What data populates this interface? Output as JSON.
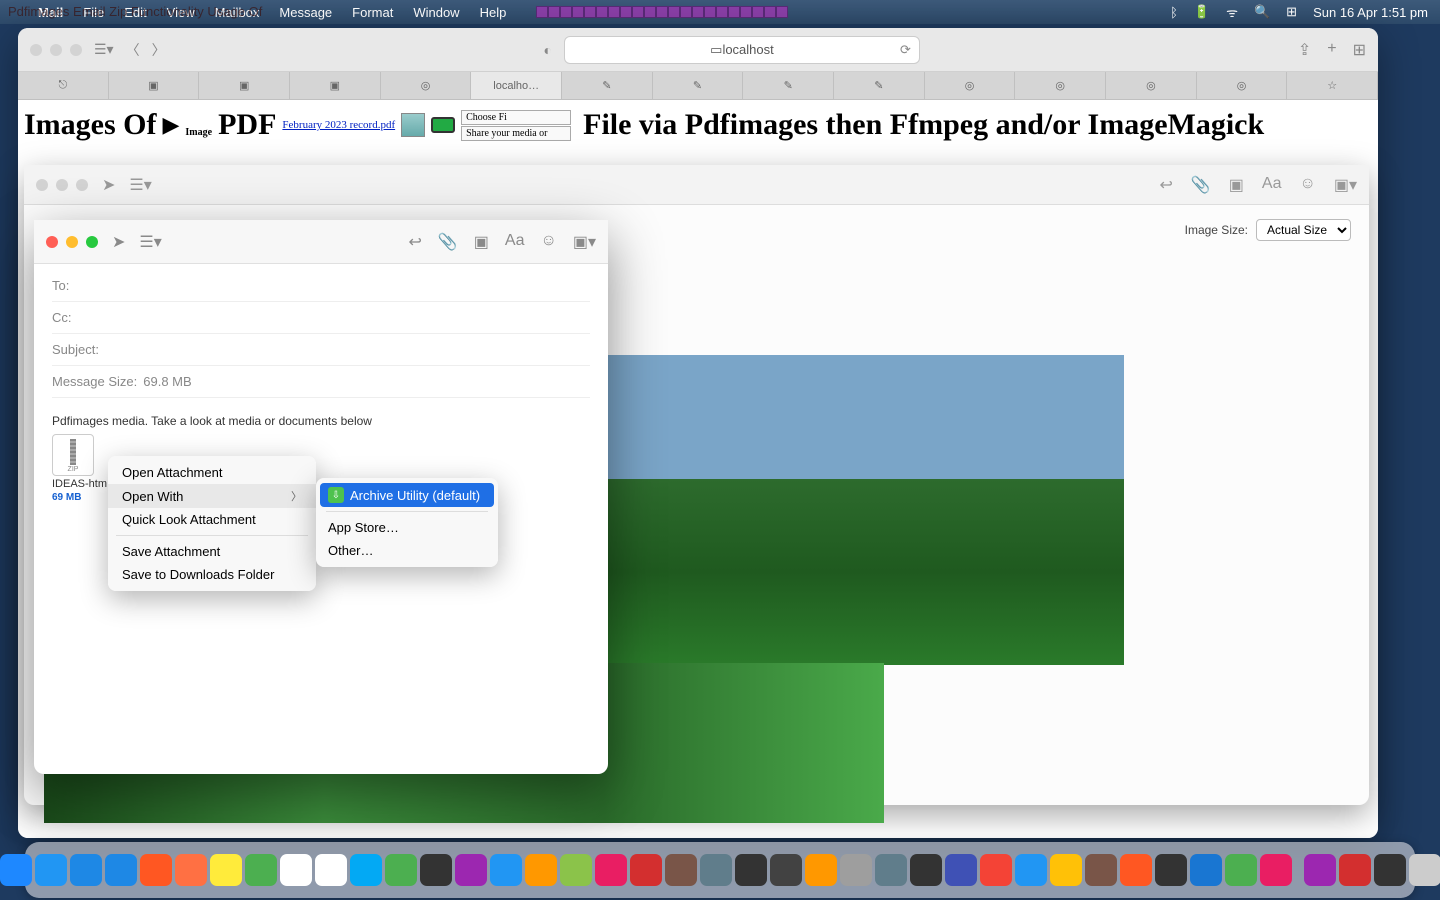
{
  "menubar": {
    "overlay": "Pdfimages Email Zip Functionality Usage Of",
    "app": "Mail",
    "items": [
      "File",
      "Edit",
      "View",
      "Mailbox",
      "Message",
      "Format",
      "Window",
      "Help"
    ],
    "clock": "Sun 16 Apr  1:51 pm"
  },
  "safari": {
    "url": "localhost",
    "tabs": [
      "",
      "",
      "",
      "",
      "",
      "localho…",
      "",
      "",
      "",
      "",
      "",
      "",
      "",
      "",
      ""
    ],
    "active_tab": 5
  },
  "page": {
    "big1": "Images Of",
    "play": "▶",
    "small": "Image",
    "big2": "PDF",
    "link": "February 2023 record.pdf",
    "choose": "Choose Fi",
    "share": "Share your media or",
    "title2": "File via Pdfimages then Ffmpeg and/or ImageMagick"
  },
  "mailback": {
    "image_size_label": "Image Size:",
    "image_size_value": "Actual Size"
  },
  "compose": {
    "to": "To:",
    "cc": "Cc:",
    "subject": "Subject:",
    "msgsize_label": "Message Size:",
    "msgsize_value": "69.8 MB",
    "body": "Pdfimages media.  Take a look at media or documents below",
    "zip_tag": "ZIP",
    "attach_name": "IDEAS-htm",
    "attach_size": "69 MB"
  },
  "ctx": {
    "open_attachment": "Open Attachment",
    "open_with": "Open With",
    "quick_look": "Quick Look Attachment",
    "save_attachment": "Save Attachment",
    "save_downloads": "Save to Downloads Folder"
  },
  "sub": {
    "archive": "Archive Utility (default)",
    "app_store": "App Store…",
    "other": "Other…"
  },
  "dock_colors": [
    "#1e88ff",
    "#2196f3",
    "#1e88e5",
    "#1e88e5",
    "#ff5722",
    "#ff7043",
    "#ffeb3b",
    "#4caf50",
    "#fff",
    "#fff",
    "#03a9f4",
    "#4caf50",
    "#333",
    "#9c27b0",
    "#2196f3",
    "#ff9800",
    "#8bc34a",
    "#e91e63",
    "#d32f2f",
    "#795548",
    "#607d8b",
    "#333",
    "#424242",
    "#ff9800",
    "#9e9e9e",
    "#607d8b",
    "#333",
    "#3f51b5",
    "#f44336",
    "#2196f3",
    "#ffc107",
    "#795548",
    "#ff5722",
    "#333",
    "#1976d2",
    "#4caf50",
    "#e91e63",
    "#9c27b0",
    "#d32f2f",
    "#333"
  ]
}
